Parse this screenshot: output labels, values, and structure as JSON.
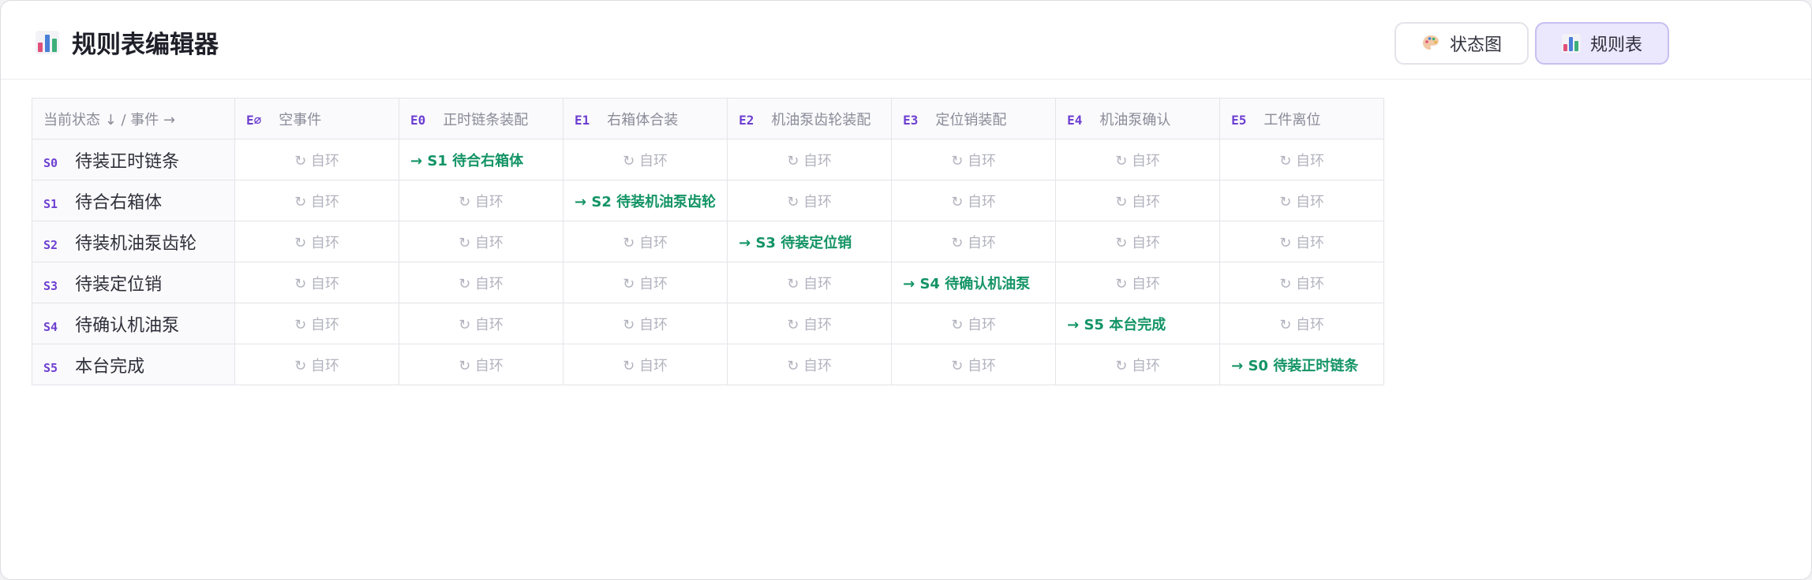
{
  "header": {
    "title": "规则表编辑器",
    "tabs": [
      {
        "label": "状态图",
        "icon": "palette-icon",
        "active": false
      },
      {
        "label": "规则表",
        "icon": "bar-chart-icon",
        "active": true
      }
    ]
  },
  "table": {
    "corner_label": "当前状态 ↓ / 事件 →",
    "self_loop_label": "↻ 自环",
    "events": [
      {
        "code": "E∅",
        "name": "空事件"
      },
      {
        "code": "E0",
        "name": "正时链条装配"
      },
      {
        "code": "E1",
        "name": "右箱体合装"
      },
      {
        "code": "E2",
        "name": "机油泵齿轮装配"
      },
      {
        "code": "E3",
        "name": "定位销装配"
      },
      {
        "code": "E4",
        "name": "机油泵确认"
      },
      {
        "code": "E5",
        "name": "工件离位"
      }
    ],
    "states": [
      {
        "code": "S0",
        "name": "待装正时链条",
        "cells": [
          "",
          "→ S1 待合右箱体",
          "",
          "",
          "",
          "",
          ""
        ]
      },
      {
        "code": "S1",
        "name": "待合右箱体",
        "cells": [
          "",
          "",
          "→ S2 待装机油泵齿轮",
          "",
          "",
          "",
          ""
        ]
      },
      {
        "code": "S2",
        "name": "待装机油泵齿轮",
        "cells": [
          "",
          "",
          "",
          "→ S3 待装定位销",
          "",
          "",
          ""
        ]
      },
      {
        "code": "S3",
        "name": "待装定位销",
        "cells": [
          "",
          "",
          "",
          "",
          "→ S4 待确认机油泵",
          "",
          ""
        ]
      },
      {
        "code": "S4",
        "name": "待确认机油泵",
        "cells": [
          "",
          "",
          "",
          "",
          "",
          "→ S5 本台完成",
          ""
        ]
      },
      {
        "code": "S5",
        "name": "本台完成",
        "cells": [
          "",
          "",
          "",
          "",
          "",
          "",
          "→ S0 待装正时链条"
        ]
      }
    ]
  },
  "colors": {
    "accent": "#6d3fd1",
    "transition": "#149466",
    "self_loop": "#b3b3bf",
    "active_tab_bg": "#ebe7fc"
  }
}
